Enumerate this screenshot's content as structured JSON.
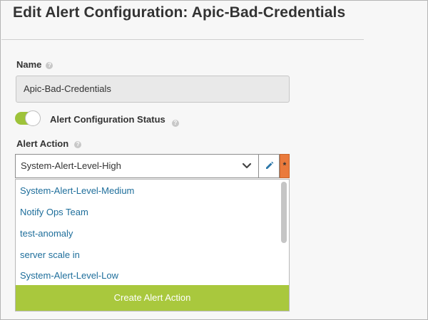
{
  "header": {
    "title": "Edit Alert Configuration: Apic-Bad-Credentials"
  },
  "name_field": {
    "label": "Name",
    "value": "Apic-Bad-Credentials"
  },
  "status_toggle": {
    "label": "Alert Configuration Status",
    "on": true,
    "color": "#9ec33a"
  },
  "alert_action": {
    "label": "Alert Action",
    "selected": "System-Alert-Level-High",
    "required_marker": "*",
    "options": [
      "System-Alert-Level-Medium",
      "Notify Ops Team",
      "test-anomaly",
      "server scale in",
      "System-Alert-Level-Low"
    ],
    "create_label": "Create Alert Action"
  },
  "colors": {
    "accent_green": "#a9c83d",
    "link_blue": "#1e6e9b",
    "required_orange": "#ea7a3c"
  }
}
